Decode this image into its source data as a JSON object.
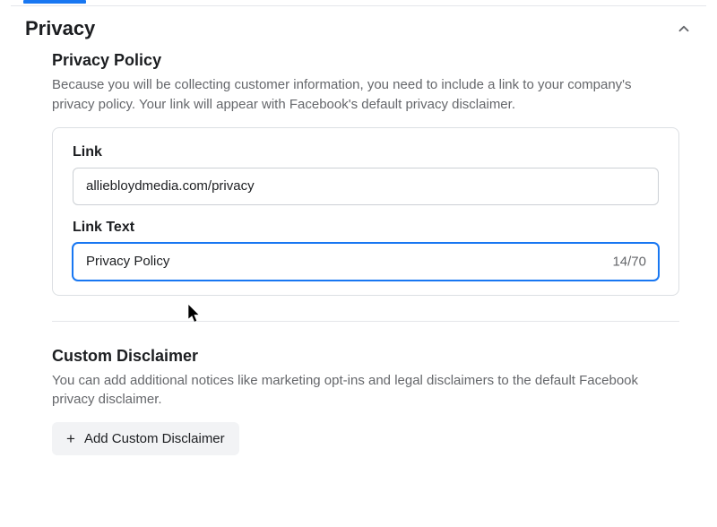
{
  "section": {
    "title": "Privacy"
  },
  "policy": {
    "heading": "Privacy Policy",
    "description": "Because you will be collecting customer information, you need to include a link to your company's privacy policy. Your link will appear with Facebook's default privacy disclaimer.",
    "link": {
      "label": "Link",
      "value": "alliebloydmedia.com/privacy"
    },
    "linkText": {
      "label": "Link Text",
      "value": "Privacy Policy",
      "counter": "14/70"
    }
  },
  "disclaimer": {
    "heading": "Custom Disclaimer",
    "description": "You can add additional notices like marketing opt-ins and legal disclaimers to the default Facebook privacy disclaimer.",
    "button": "Add Custom Disclaimer"
  }
}
